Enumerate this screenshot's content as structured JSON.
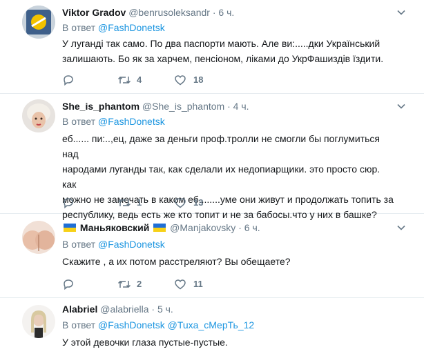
{
  "colors": {
    "accent": "#1b95e0",
    "muted": "#657786",
    "text": "#14171a",
    "divider": "#e6ecf0",
    "flag_blue": "#1f6fd6",
    "flag_yellow": "#f7d117"
  },
  "reply_prefix": "В ответ",
  "tweets": [
    {
      "name": "Viktor Gradov",
      "handle": "@benrusoleksandr",
      "time": "6 ч.",
      "mentions": [
        "@FashDonetsk"
      ],
      "text_lines": [
        "У луганді так само. По два паспорти мають. Але ви:.....дки Український",
        "залишають. Бо як за харчем, пенсіоном, ліками до УкрФашиздів їздити."
      ],
      "replies": "",
      "retweets": "4",
      "likes": "18"
    },
    {
      "name": "She_is_phantom",
      "handle": "@She_is_phantom",
      "time": "4 ч.",
      "mentions": [
        "@FashDonetsk"
      ],
      "text_lines": [
        "еб...... пи:..,ец, даже за деньги проф.тролли не смогли бы поглумиться над",
        "народами луганды так, как сделали их недопиарщики. это просто сюр. как",
        "можно не замечать в каком еб........уме они живут и продолжать топить за",
        "республику, ведь есть же кто топит и не за бабосы.что у них в башке?"
      ],
      "replies": "",
      "retweets": "1",
      "likes": "13"
    },
    {
      "name": "Маньяковский",
      "handle": "@Manjakovsky",
      "time": "6 ч.",
      "mentions": [
        "@FashDonetsk"
      ],
      "text_lines": [
        "Скажите , а их потом расстреляют? Вы обещаете?"
      ],
      "replies": "",
      "retweets": "2",
      "likes": "11"
    },
    {
      "name": "Alabriel",
      "handle": "@alabriella",
      "time": "5 ч.",
      "mentions": [
        "@FashDonetsk",
        "@Tuxa_сМерТь_12"
      ],
      "text_lines": [
        "У этой девочки глаза пустые-пустые."
      ]
    }
  ]
}
